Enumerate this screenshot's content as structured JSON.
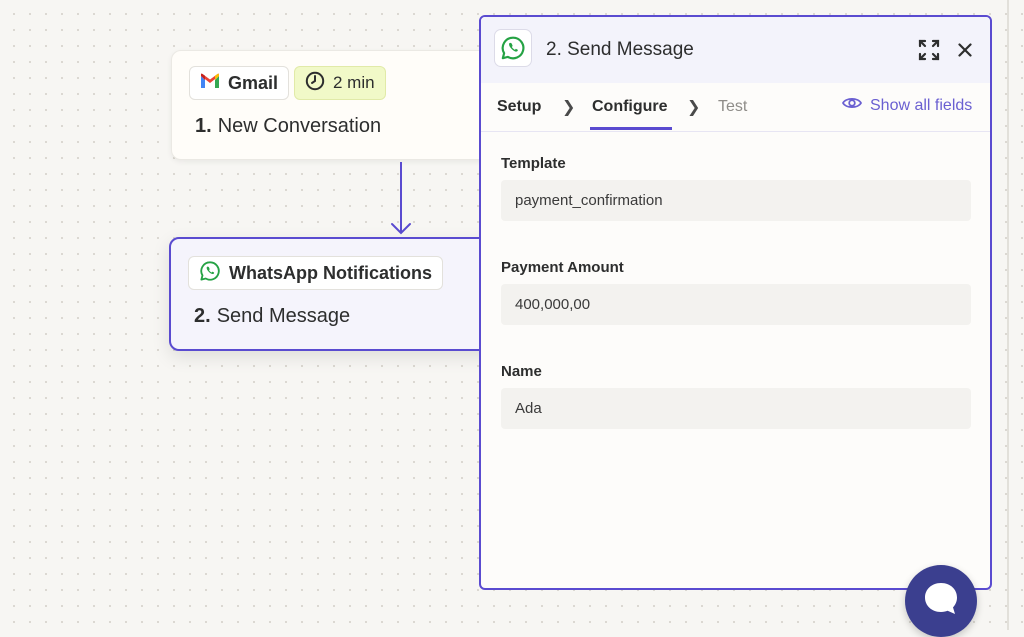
{
  "canvas": {
    "trigger_step": {
      "app_name": "Gmail",
      "app_icon": "gmail-icon",
      "delay_label": "2 min",
      "delay_icon": "clock-icon",
      "step_number": "1.",
      "step_title": "New Conversation"
    },
    "action_step": {
      "app_name": "WhatsApp Notifications",
      "app_icon": "whatsapp-icon",
      "step_number": "2.",
      "step_title": "Send Message"
    }
  },
  "panel": {
    "title": "2. Send Message",
    "app_icon": "whatsapp-icon",
    "tabs": {
      "setup": "Setup",
      "configure": "Configure",
      "test": "Test",
      "active": "Configure"
    },
    "show_all_fields": "Show all fields",
    "fields": [
      {
        "label": "Template",
        "value": "payment_confirmation"
      },
      {
        "label": "Payment Amount",
        "value": "400,000,00"
      },
      {
        "label": "Name",
        "value": "Ada"
      }
    ]
  },
  "colors": {
    "accent": "#5a4bd0",
    "whatsapp_green": "#25a244",
    "delay_chip_bg": "#f1f9c8",
    "chat_button": "#3b3f8f"
  }
}
